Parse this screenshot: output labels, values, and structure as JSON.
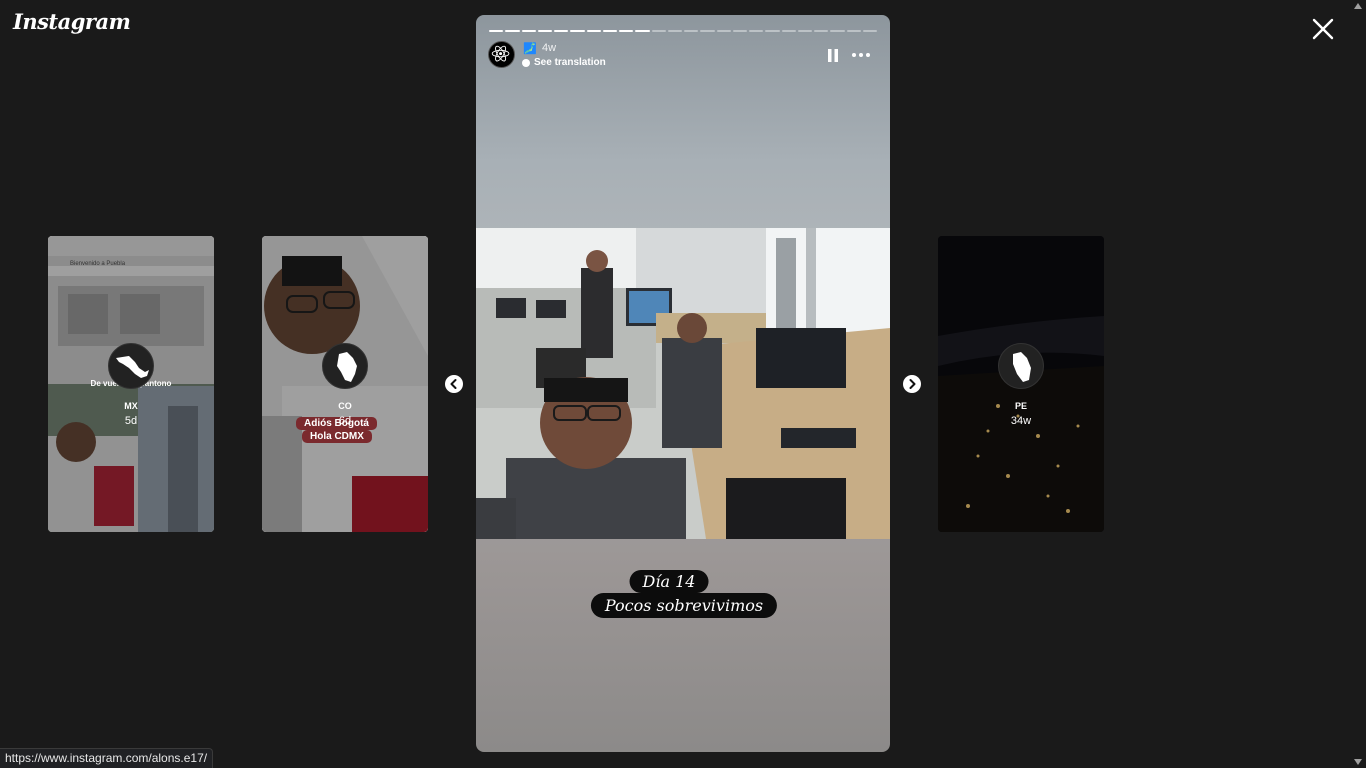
{
  "app": {
    "logo": "Instagram"
  },
  "story": {
    "time": "4w",
    "flag_emoji": "🗾",
    "see_translation": "See translation",
    "caption_line1": "Día 14",
    "caption_line2": "Pocos sobrevivimos",
    "progress": {
      "total_segments": 24,
      "completed_segments": 10
    }
  },
  "previews": [
    {
      "username": "MX",
      "age": "5d",
      "overlay_text": "De vuelta en pantono",
      "sign_text": "Bienvenido a Puebla"
    },
    {
      "username": "CO",
      "age": "6d",
      "overlay_line1": "Adiós Bogotá",
      "overlay_line2": "Hola CDMX"
    },
    {
      "username": "PE",
      "age": "34w"
    }
  ],
  "status_bar": {
    "url": "https://www.instagram.com/alons.e17/"
  },
  "colors": {
    "background": "#1a1a1a",
    "caption_bg": "#0c0c0c",
    "text": "#ffffff"
  }
}
